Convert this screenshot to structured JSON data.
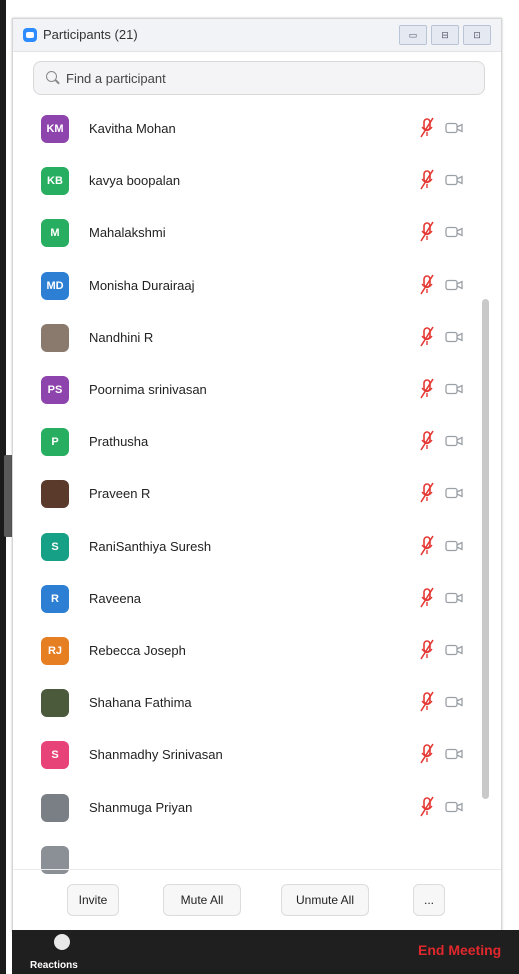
{
  "window": {
    "title": "Participants (21)",
    "controls": [
      "▭",
      "⊟",
      "⊡"
    ]
  },
  "search": {
    "placeholder": "Find a participant"
  },
  "participants": [
    {
      "initials": "KM",
      "name": "Kavitha Mohan",
      "color": "#8e44ad"
    },
    {
      "initials": "KB",
      "name": "kavya boopalan",
      "color": "#27ae60"
    },
    {
      "initials": "M",
      "name": "Mahalakshmi",
      "color": "#27ae60"
    },
    {
      "initials": "MD",
      "name": "Monisha Durairaaj",
      "color": "#2d7fd3"
    },
    {
      "initials": "",
      "name": "Nandhini R",
      "color": "#8a7a6e",
      "photo": true
    },
    {
      "initials": "PS",
      "name": "Poornima srinivasan",
      "color": "#8e44ad"
    },
    {
      "initials": "P",
      "name": "Prathusha",
      "color": "#27ae60"
    },
    {
      "initials": "",
      "name": "Praveen R",
      "color": "#5a3a2a",
      "photo": true
    },
    {
      "initials": "S",
      "name": "RaniSanthiya Suresh",
      "color": "#16a085"
    },
    {
      "initials": "R",
      "name": "Raveena",
      "color": "#2d7fd3"
    },
    {
      "initials": "RJ",
      "name": "Rebecca Joseph",
      "color": "#e67e22"
    },
    {
      "initials": "",
      "name": "Shahana Fathima",
      "color": "#4a5a3a",
      "photo": true
    },
    {
      "initials": "S",
      "name": "Shanmadhy Srinivasan",
      "color": "#e84378"
    },
    {
      "initials": "",
      "name": "Shanmuga Priyan",
      "color": "#7a7f86",
      "photo": true
    }
  ],
  "colors": {
    "muted_mic": "#e53935",
    "camera_off": "#9aa0a6"
  },
  "footer": {
    "invite": "Invite",
    "mute_all": "Mute All",
    "unmute_all": "Unmute All",
    "more": "..."
  },
  "meeting_bar": {
    "reactions": "Reactions",
    "end_meeting": "End Meeting"
  }
}
